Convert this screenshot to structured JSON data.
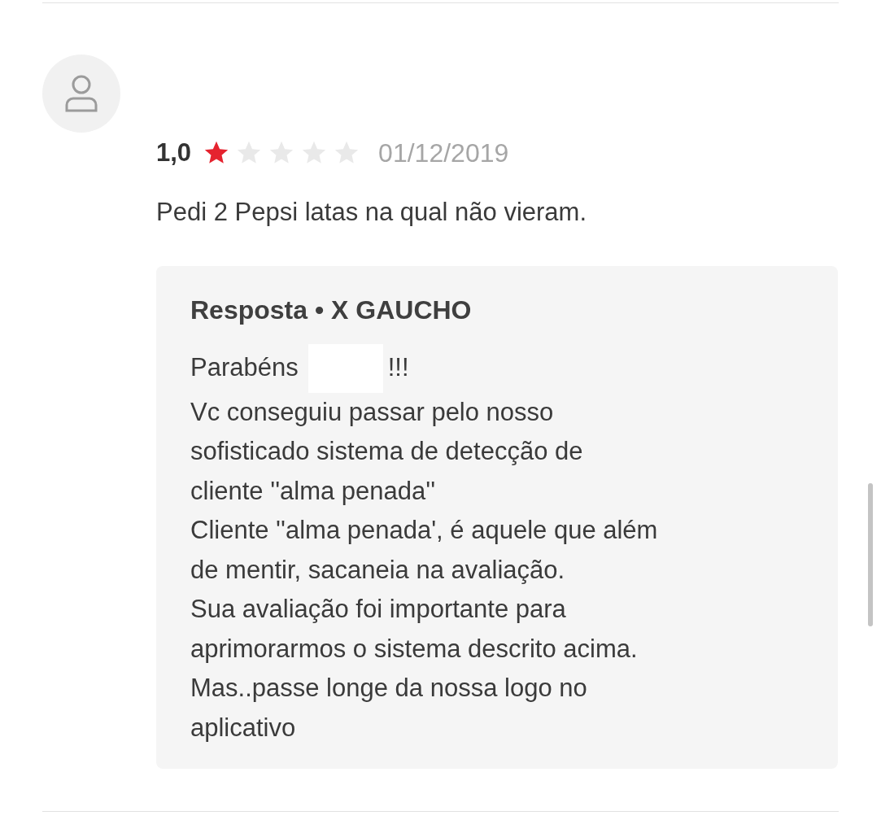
{
  "review": {
    "rating": "1,0",
    "stars": 1,
    "date": "01/12/2019",
    "text": "Pedi 2 Pepsi latas na qual não vieram."
  },
  "reply": {
    "title": "Resposta • X GAUCHO",
    "greeting": {
      "before": "Parabéns",
      "redacted": true,
      "after": "!!!"
    },
    "lines": [
      "Vc conseguiu passar pelo nosso",
      "sofisticado sistema de detecção de",
      "cliente ''alma penada''",
      "Cliente ''alma penada', é aquele que além",
      "de mentir, sacaneia na avaliação.",
      "Sua avaliação foi importante para",
      "aprimorarmos o sistema descrito acima.",
      "Mas..passe longe da nossa logo no",
      "aplicativo"
    ]
  }
}
